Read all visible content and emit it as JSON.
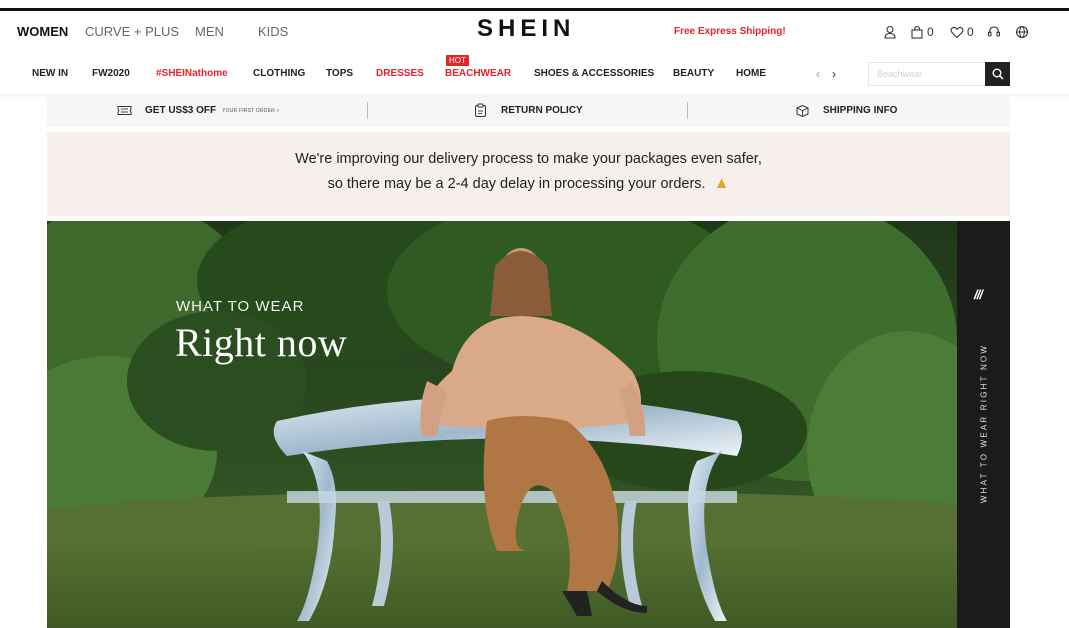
{
  "header": {
    "categories": [
      {
        "label": "WOMEN",
        "active": true
      },
      {
        "label": "CURVE + PLUS",
        "active": false
      },
      {
        "label": "MEN",
        "active": false
      },
      {
        "label": "KIDS",
        "active": false
      }
    ],
    "logo": "SHEIN",
    "promo": "Free Express Shipping!",
    "icons": [
      {
        "name": "user-icon"
      },
      {
        "name": "bag-icon",
        "count": "0"
      },
      {
        "name": "wishlist-icon",
        "count": "0"
      },
      {
        "name": "support-icon"
      },
      {
        "name": "globe-icon"
      }
    ]
  },
  "nav": {
    "items": [
      {
        "label": "NEW IN"
      },
      {
        "label": "FW2020"
      },
      {
        "label": "#SHEINathome"
      },
      {
        "label": "CLOTHING"
      },
      {
        "label": "TOPS"
      },
      {
        "label": "DRESSES"
      },
      {
        "label": "BEACHWEAR"
      },
      {
        "label": "SHOES & ACCESSORIES"
      },
      {
        "label": "BEAUTY"
      },
      {
        "label": "HOME"
      }
    ],
    "hot_badge": "HOT",
    "arrow_prev": "‹",
    "arrow_next": "›",
    "search_placeholder": "Beachwear"
  },
  "infobar": {
    "coupon_title": "GET US$3 OFF",
    "coupon_sub": "YOUR FIRST ORDER »",
    "return_policy": "RETURN POLICY",
    "shipping_info": "SHIPPING INFO"
  },
  "notice": {
    "line1": "We're improving our delivery process to make your packages even safer,",
    "line2": "so there may be a 2-4 day delay in processing your orders."
  },
  "hero": {
    "kicker": "WHAT TO WEAR",
    "title": "Right now",
    "side_mark": "///",
    "side_text": "WHAT TO WEAR RIGHT NOW"
  },
  "colors": {
    "accent_red": "#e2252b",
    "notice_bg": "#f6efeb",
    "info_bg": "#f6f6f6"
  }
}
